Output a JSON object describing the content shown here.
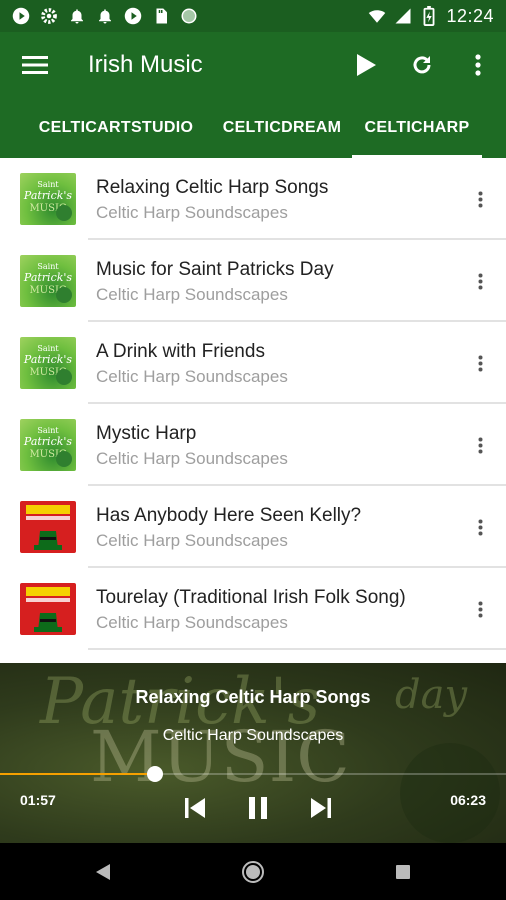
{
  "status_bar": {
    "time": "12:24",
    "left_icons": [
      "play-circle-icon",
      "settings-icon",
      "notification-icon",
      "notification-icon",
      "play-circle-icon",
      "sd-card-icon",
      "circle-icon"
    ],
    "right_icons": [
      "wifi-icon",
      "signal-icon",
      "battery-charging-icon"
    ]
  },
  "app_bar": {
    "title": "Irish Music",
    "actions": [
      "play-icon",
      "refresh-icon",
      "more-vert-icon"
    ],
    "color": "#1e6b24"
  },
  "tabs": [
    {
      "label": "CELTICARTSTUDIO",
      "selected": false
    },
    {
      "label": "CELTICDREAM",
      "selected": false
    },
    {
      "label": "CELTICHARP",
      "selected": true
    }
  ],
  "tracks": [
    {
      "title": "Relaxing Celtic Harp Songs",
      "artist": "Celtic Harp Soundscapes",
      "art": "green"
    },
    {
      "title": "Music for Saint Patricks Day",
      "artist": "Celtic Harp Soundscapes",
      "art": "green"
    },
    {
      "title": "A Drink with Friends",
      "artist": "Celtic Harp Soundscapes",
      "art": "green"
    },
    {
      "title": "Mystic Harp",
      "artist": "Celtic Harp Soundscapes",
      "art": "green"
    },
    {
      "title": "Has Anybody Here Seen Kelly?",
      "artist": "Celtic Harp Soundscapes",
      "art": "red"
    },
    {
      "title": "Tourelay (Traditional Irish Folk Song)",
      "artist": "Celtic Harp Soundscapes",
      "art": "red"
    }
  ],
  "now_playing": {
    "title": "Relaxing Celtic Harp Songs",
    "artist": "Celtic Harp Soundscapes",
    "elapsed": "01:57",
    "duration": "06:23",
    "progress": 0.307,
    "accent": "#f5a000"
  },
  "nav_bar": [
    "back-icon",
    "home-icon",
    "recents-icon"
  ]
}
